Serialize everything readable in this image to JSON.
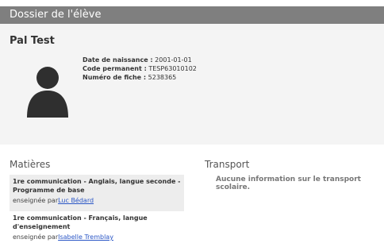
{
  "page": {
    "title": "Dossier de l'élève"
  },
  "student": {
    "name": "Pal Test",
    "birth_label": "Date de naissance :",
    "birth_value": "2001-01-01",
    "code_label": "Code permanent :",
    "code_value": "TESP63010102",
    "file_label": "Numéro de fiche :",
    "file_value": "5238365"
  },
  "matieres": {
    "title": "Matières",
    "items": [
      {
        "name": "1re communication - Anglais, langue seconde - Programme de base",
        "taught_by": "enseignée par",
        "teacher": "Luc Bédard"
      },
      {
        "name": "1re communication - Français, langue d'enseignement",
        "taught_by": "enseignée par",
        "teacher": "Isabelle Tremblay"
      }
    ]
  },
  "transport": {
    "title": "Transport",
    "message": "Aucune information sur le transport scolaire."
  },
  "icons": {
    "avatar": "person-silhouette-icon"
  }
}
